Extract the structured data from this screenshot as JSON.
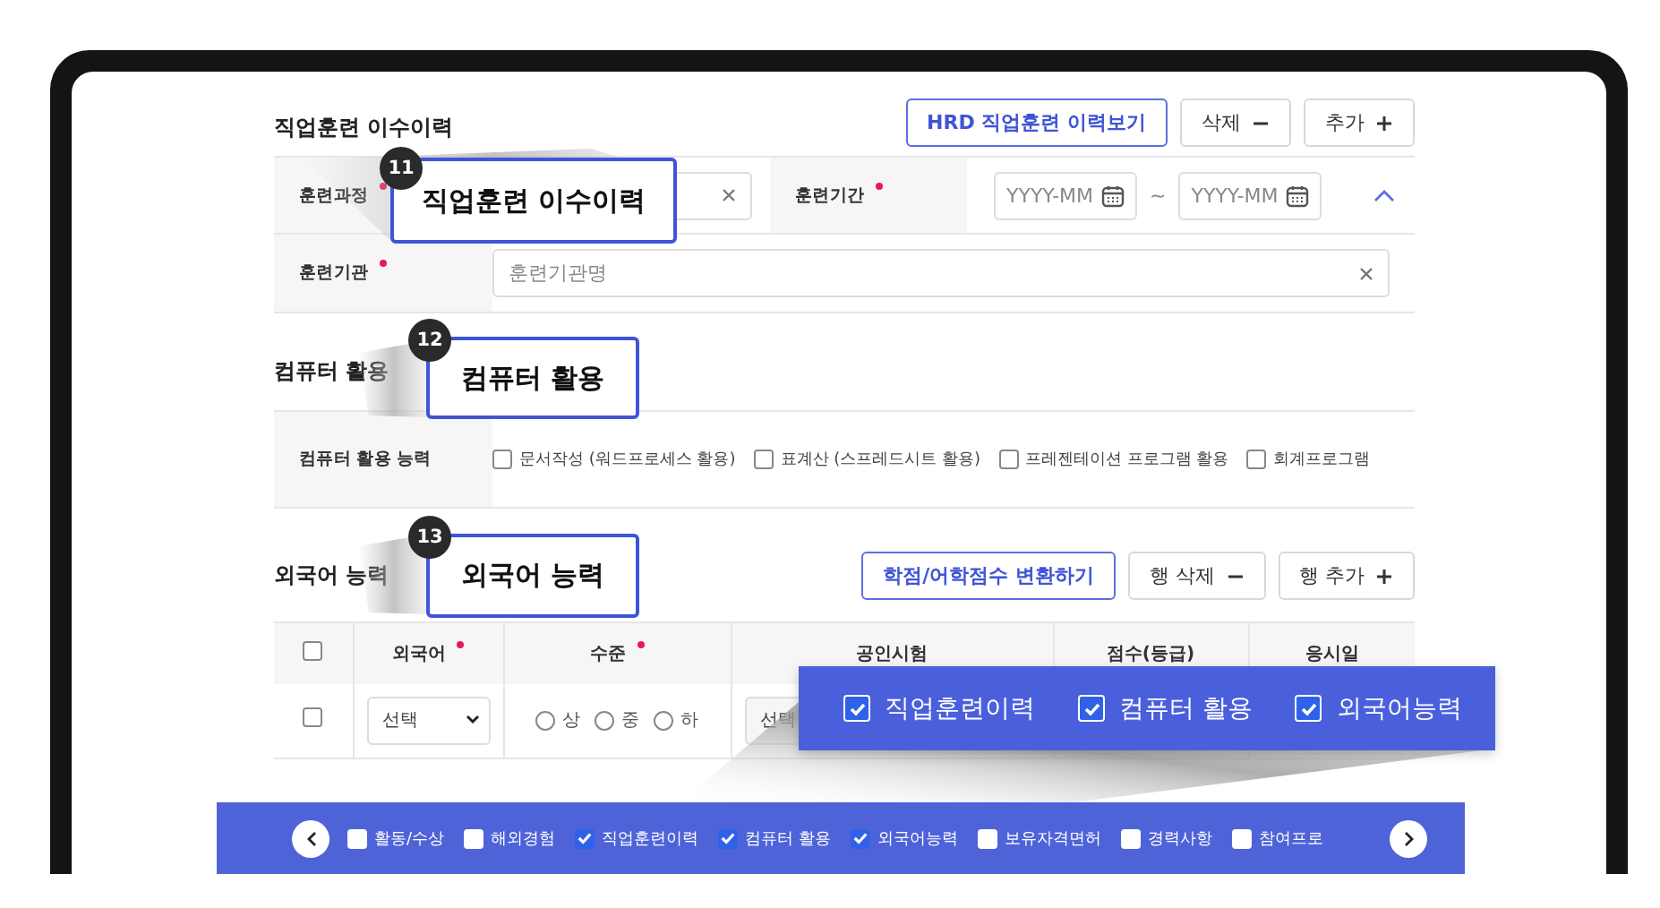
{
  "training": {
    "title": "직업훈련 이수이력",
    "buttons": [
      {
        "label": "HRD 직업훈련 이력보기",
        "kind": "primary"
      },
      {
        "label": "삭제",
        "kind": "minus"
      },
      {
        "label": "추가",
        "kind": "plus"
      }
    ],
    "course": {
      "label": "훈련과정",
      "required": true
    },
    "period": {
      "label": "훈련기간",
      "required": true,
      "start_placeholder": "YYYY-MM",
      "separator": "~",
      "end_placeholder": "YYYY-MM",
      "expanded": true
    },
    "institution": {
      "label": "훈련기관",
      "required": true,
      "placeholder": "훈련기관명"
    }
  },
  "computer": {
    "title": "컴퓨터 활용",
    "label": "컴퓨터 활용 능력",
    "options": [
      {
        "label": "문서작성 (워드프로세스 활용)",
        "checked": false
      },
      {
        "label": "표계산 (스프레드시트 활용)",
        "checked": false
      },
      {
        "label": "프레젠테이션 프로그램 활용",
        "checked": false
      },
      {
        "label": "회계프로그램",
        "checked": false
      }
    ]
  },
  "language": {
    "title": "외국어 능력",
    "buttons": [
      {
        "label": "학점/어학점수 변환하기",
        "kind": "primary"
      },
      {
        "label": "행 삭제",
        "kind": "minus"
      },
      {
        "label": "행 추가",
        "kind": "plus"
      }
    ],
    "header_checked": false,
    "columns": [
      {
        "label": "외국어",
        "required": true
      },
      {
        "label": "수준",
        "required": true
      },
      {
        "label": "공인시험",
        "required": false
      },
      {
        "label": "점수(등급)",
        "required": false
      },
      {
        "label": "응시일",
        "required": false
      }
    ],
    "row": {
      "checked": false,
      "language": "선택",
      "levels": [
        {
          "label": "상",
          "selected": false
        },
        {
          "label": "중",
          "selected": false
        },
        {
          "label": "하",
          "selected": false
        }
      ],
      "test": "선택"
    }
  },
  "callouts": [
    {
      "number": "11",
      "text": "직업훈련 이수이력"
    },
    {
      "number": "12",
      "text": "컴퓨터 활용"
    },
    {
      "number": "13",
      "text": "외국어 능력"
    }
  ],
  "overlay": {
    "items": [
      {
        "label": "직업훈련이력",
        "checked": true
      },
      {
        "label": "컴퓨터 활용",
        "checked": true
      },
      {
        "label": "외국어능력",
        "checked": true
      }
    ]
  },
  "bottom_bar": {
    "items": [
      {
        "label": "활동/수상",
        "checked": false
      },
      {
        "label": "해외경험",
        "checked": false
      },
      {
        "label": "직업훈련이력",
        "checked": true
      },
      {
        "label": "컴퓨터 활용",
        "checked": true
      },
      {
        "label": "외국어능력",
        "checked": true
      },
      {
        "label": "보유자격면허",
        "checked": false
      },
      {
        "label": "경력사항",
        "checked": false
      },
      {
        "label": "참여프로",
        "checked": false
      }
    ]
  }
}
